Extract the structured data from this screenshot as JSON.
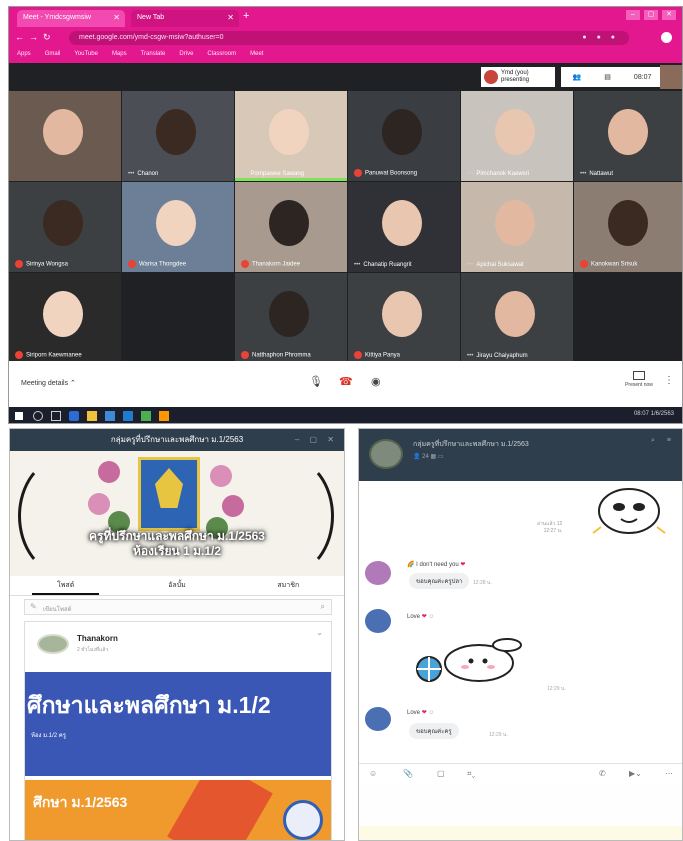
{
  "browser": {
    "tabs": [
      {
        "label": "Meet - Ymdcsgwmsiw"
      },
      {
        "label": "New Tab"
      }
    ],
    "address": "meet.google.com/ymd-csgw-msiw?authuser=0",
    "bookmarks": [
      "Apps",
      "Gmail",
      "YouTube",
      "Maps",
      "Translate",
      "Drive",
      "Classroom",
      "Meet"
    ],
    "colors": {
      "chrome": "#e3178e"
    }
  },
  "meet": {
    "presenter": {
      "line1": "Ymd (you)",
      "line2": "presenting"
    },
    "clock": "08:07",
    "meeting_details": "Meeting details",
    "participants": [
      {
        "name": "",
        "muted": false
      },
      {
        "name": "Chanon",
        "muted": false
      },
      {
        "name": "Pornpawee Sawang",
        "muted": false,
        "speaking": true
      },
      {
        "name": "Panuwat Boonsong",
        "muted": true
      },
      {
        "name": "Pimchanok Kaewsri",
        "muted": false
      },
      {
        "name": "Nattawut",
        "muted": false
      },
      {
        "name": "Sirinya Wongsa",
        "muted": true
      },
      {
        "name": "Warisa Thongdee",
        "muted": true
      },
      {
        "name": "Thanakorn Jaidee",
        "muted": true
      },
      {
        "name": "Chanatip Ruangrit",
        "muted": false
      },
      {
        "name": "Apichai Suksawat",
        "muted": false
      },
      {
        "name": "Kanokwan Srisuk",
        "muted": true
      },
      {
        "name": "Siriporn Kaewmanee",
        "muted": true
      },
      {
        "name": "Natthaphon Phromma",
        "muted": true
      },
      {
        "name": "Kittiya Panya",
        "muted": true
      },
      {
        "name": "Jirayu Chaiyaphum",
        "muted": false
      }
    ],
    "present_label": "Present now",
    "taskbar_time": "08:07",
    "taskbar_date": "1/6/2563"
  },
  "line_group": {
    "window_title": "กลุ่มครูที่ปรึกษาและพลศึกษา ม.1/2563",
    "cover_line1": "ครูที่ปรึกษาและพลศึกษา ม.1/2563",
    "cover_line2": "ห้องเรียน 1 ม.1/2",
    "tabs": [
      "โพสต์",
      "อัลบั้ม",
      "สมาชิก"
    ],
    "search_placeholder": "เขียนโพสต์",
    "post_author": "Thanakorn",
    "post_sub": "2 ชั่วโมงที่แล้ว",
    "banner1_big": "ศึกษาและพลศึกษา ม.1/2",
    "banner1_small": "ห้อง ม.1/2 ครู",
    "banner2_text": "ศึกษา ม.1/2563"
  },
  "line_chat": {
    "title": "กลุ่มครูที่ปรึกษาและพลศึกษา ม.1/2563",
    "members": "24",
    "read_label": "อ่านแล้ว 12",
    "read_time": "12:27 น.",
    "messages": [
      {
        "name": "I don't need you",
        "text": "ขอบคุณค่ะครูปลา",
        "time": "12:28 น."
      },
      {
        "name": "Love",
        "text": "",
        "time": "12:29 น."
      },
      {
        "name": "Love",
        "text": "ขอบคุณค่ะครู",
        "time": "12:29 น."
      }
    ]
  }
}
